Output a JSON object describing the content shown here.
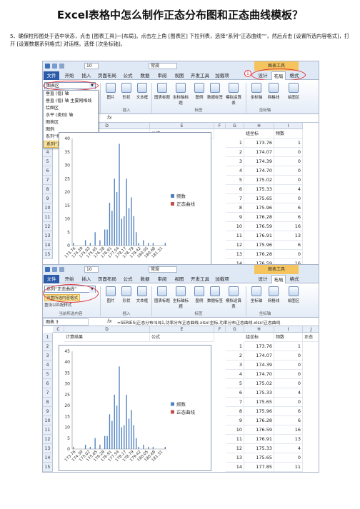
{
  "title": "Excel表格中怎么制作正态分布图和正态曲线模板？",
  "step": "5、确保柱形图处于选中状态，点击 [图表工具]一[布局]。点击左上角 [图表区] 下拉列表，选择“系列“正态曲线””，然后点击 [设置所选内容格式]，打开 [设置数据系列格式] 对话框。选择 [次坐标轴]。",
  "ribbon": {
    "font_size": "10",
    "style": "常规",
    "chart_tools": "图表工具",
    "tabs": [
      "文件",
      "开始",
      "插入",
      "页面布局",
      "公式",
      "数据",
      "审阅",
      "视图",
      "开发工具",
      "加载项",
      "设计",
      "布局",
      "格式"
    ],
    "groups": [
      "插入",
      "标签",
      "坐标轴"
    ],
    "buttons": [
      "图片",
      "形状",
      "文本框",
      "图表标题",
      "坐标轴标题",
      "图例",
      "数据标签",
      "模拟运算表",
      "坐标轴",
      "网格线",
      "绘图区"
    ],
    "current_selection": "当前所选内容",
    "format_selection": "设置所选内容格式",
    "reset_style": "重设以匹配样式",
    "badge_1": "1",
    "badge_2": "2",
    "badge_3": "3"
  },
  "dropdown1": {
    "value": "图表区",
    "items": [
      "垂直 (值) 轴",
      "垂直 (值) 轴 主要网格线",
      "绘图区",
      "水平 (类别) 轴",
      "图表区",
      "图例",
      "系列“频数”",
      "系列“正态曲线”"
    ]
  },
  "dropdown2": {
    "value": "系列“正态曲线”"
  },
  "formula1": {
    "fx": "fx",
    "value": ""
  },
  "formula2": {
    "namebox": "图表 3",
    "fx": "fx",
    "value": "=SERIES(正态分布!$I$1,功率分布正态曲线.xlsx!坐标,功率分布正态曲线.xlsx!正态曲线"
  },
  "grid_headers1": [
    "C",
    "D",
    "E",
    "F",
    "G",
    "H",
    "I"
  ],
  "grid_headers2": [
    "C",
    "D",
    "E",
    "F",
    "G",
    "H",
    "I",
    "J"
  ],
  "grid_top_row": {
    "d": "计算结果",
    "e": "公式",
    "h": "组坐标",
    "i": "频数",
    "j": "正态"
  },
  "row_numbers1": [
    "2",
    "3",
    "4",
    "5",
    "6",
    "7",
    "8",
    "9",
    "10",
    "11",
    "12",
    "13",
    "14",
    "15"
  ],
  "row_numbers2": [
    "1",
    "2",
    "3",
    "4",
    "5",
    "6",
    "7",
    "8",
    "9",
    "10",
    "11",
    "12",
    "13",
    "14",
    "15"
  ],
  "table1": {
    "g": [
      "1",
      "2",
      "3",
      "4",
      "5",
      "6",
      "7",
      "8",
      "9",
      "10",
      "11",
      "12",
      "13",
      "14"
    ],
    "h": [
      "173.76",
      "174.07",
      "174.39",
      "174.70",
      "175.02",
      "175.33",
      "175.65",
      "175.96",
      "176.28",
      "176.59",
      "176.91",
      "175.96",
      "176.28",
      "176.59"
    ],
    "i": [
      "1",
      "0",
      "0",
      "0",
      "0",
      "4",
      "0",
      "6",
      "6",
      "16",
      "13",
      "6",
      "0",
      "16"
    ]
  },
  "table2": {
    "g": [
      "1",
      "2",
      "3",
      "4",
      "5",
      "6",
      "7",
      "8",
      "9",
      "10",
      "11",
      "12",
      "13",
      "14"
    ],
    "h": [
      "173.76",
      "174.07",
      "174.39",
      "174.70",
      "175.02",
      "175.33",
      "175.65",
      "175.96",
      "176.28",
      "176.59",
      "176.91",
      "175.33",
      "175.65",
      "177.85"
    ],
    "i": [
      "1",
      "0",
      "0",
      "0",
      "0",
      "4",
      "0",
      "6",
      "6",
      "16",
      "13",
      "4",
      "0",
      "11"
    ]
  },
  "chart_data": [
    {
      "type": "bar",
      "categories": [
        "173.76",
        "174.39",
        "175.02",
        "175.65",
        "176.28",
        "176.91",
        "177.54",
        "178.17",
        "178.79",
        "179.42",
        "180.05",
        "180.68",
        "181.31"
      ],
      "series": [
        {
          "name": "频数",
          "values": [
            1,
            0,
            0,
            0,
            0,
            2,
            0,
            1,
            0,
            5,
            0,
            2,
            0,
            6,
            6,
            16,
            13,
            25,
            20,
            38,
            10,
            11,
            25,
            14,
            18,
            11,
            5,
            1,
            0,
            2,
            0,
            1,
            0,
            1,
            0,
            0,
            0,
            0,
            1
          ]
        },
        {
          "name": "正态曲线",
          "values": []
        }
      ],
      "ylim": [
        0,
        40
      ],
      "yticks": [
        0,
        5,
        10,
        15,
        20,
        25,
        30,
        35,
        40
      ],
      "legend": "right"
    },
    {
      "type": "bar",
      "categories": [
        "173.76",
        "174.39",
        "175.02",
        "175.65",
        "176.28",
        "176.91",
        "177.54",
        "178.17",
        "178.79",
        "179.42",
        "180.05",
        "180.68",
        "181.31"
      ],
      "series": [
        {
          "name": "频数",
          "values": [
            1,
            0,
            0,
            0,
            0,
            2,
            0,
            1,
            0,
            5,
            0,
            2,
            0,
            6,
            6,
            16,
            13,
            25,
            20,
            38,
            10,
            11,
            25,
            14,
            18,
            11,
            5,
            1,
            0,
            2,
            0,
            1,
            0,
            1,
            0,
            0,
            0,
            0,
            1
          ]
        },
        {
          "name": "正态曲线",
          "values": []
        }
      ],
      "ylim": [
        0,
        45
      ],
      "yticks": [
        0,
        5,
        10,
        15,
        20,
        25,
        30,
        35,
        40,
        45
      ],
      "legend": "right"
    }
  ],
  "colors": {
    "bar": "#4f81bd",
    "curve": "#c0504d",
    "accent": "#e0343a"
  }
}
